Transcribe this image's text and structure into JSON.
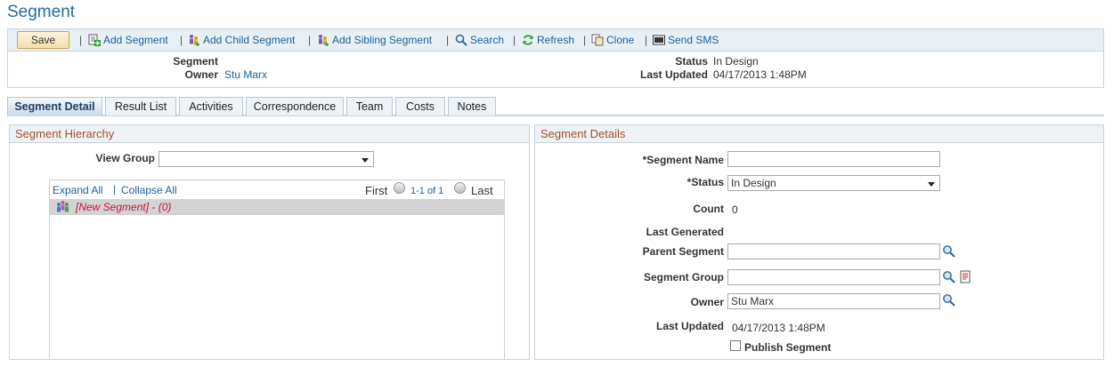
{
  "page": {
    "title": "Segment"
  },
  "toolbar": {
    "save_label": "Save",
    "add_segment": "Add Segment",
    "add_child_segment": "Add Child Segment",
    "add_sibling_segment": "Add Sibling Segment",
    "search": "Search",
    "refresh": "Refresh",
    "clone": "Clone",
    "send_sms": "Send SMS",
    "separator": "|"
  },
  "header": {
    "segment_label": "Segment",
    "segment_value": "",
    "owner_label": "Owner",
    "owner_value": "Stu Marx",
    "status_label": "Status",
    "status_value": "In Design",
    "last_updated_label": "Last Updated",
    "last_updated_value": "04/17/2013  1:48PM"
  },
  "tabs": [
    {
      "label": "Segment Detail",
      "active": true
    },
    {
      "label": "Result List"
    },
    {
      "label": "Activities"
    },
    {
      "label": "Correspondence"
    },
    {
      "label": "Team"
    },
    {
      "label": "Costs"
    },
    {
      "label": "Notes"
    }
  ],
  "hierarchy": {
    "title": "Segment Hierarchy",
    "view_group_label": "View Group",
    "view_group_value": "",
    "expand_all": "Expand All",
    "collapse_all": "Collapse All",
    "sep": "|",
    "first": "First",
    "range": "1-1 of 1",
    "last": "Last",
    "node_label": "[New Segment] - (0)"
  },
  "details": {
    "title": "Segment Details",
    "segment_name_label": "*Segment Name",
    "segment_name_value": "",
    "status_label": "*Status",
    "status_value": "In Design",
    "count_label": "Count",
    "count_value": "0",
    "last_generated_label": "Last Generated",
    "parent_segment_label": "Parent Segment",
    "parent_segment_value": "",
    "segment_group_label": "Segment Group",
    "segment_group_value": "",
    "owner_label": "Owner",
    "owner_value": "Stu Marx",
    "last_updated_label": "Last Updated",
    "last_updated_value": "04/17/2013  1:48PM",
    "publish_label": "Publish Segment"
  },
  "colors": {
    "accent": "#1a5fa0",
    "section_title": "#a0522d",
    "tree_node": "#c4143c"
  }
}
